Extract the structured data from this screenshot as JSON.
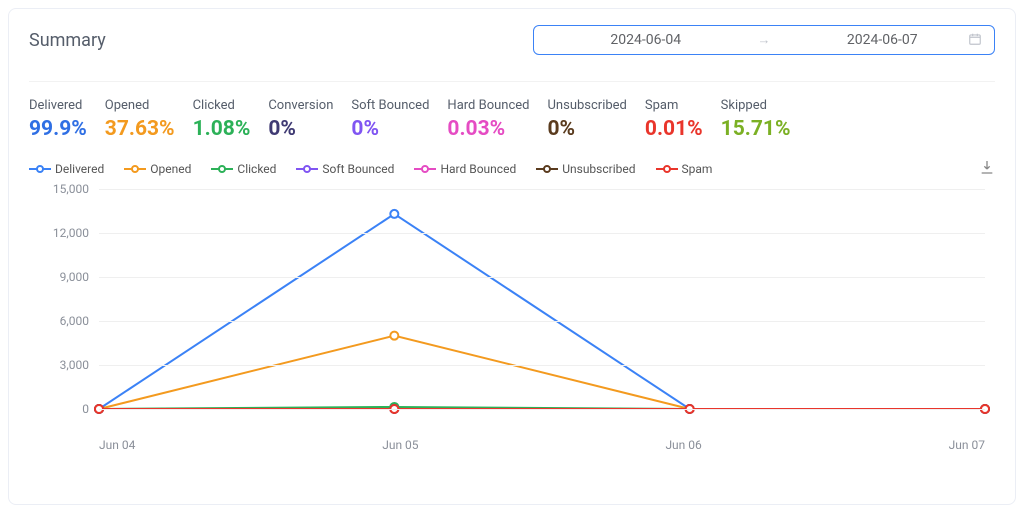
{
  "header": {
    "title": "Summary",
    "date_from": "2024-06-04",
    "date_to": "2024-06-07"
  },
  "stats": [
    {
      "label": "Delivered",
      "value": "99.9%",
      "color": "#2f6fe4"
    },
    {
      "label": "Opened",
      "value": "37.63%",
      "color": "#f39a1f"
    },
    {
      "label": "Clicked",
      "value": "1.08%",
      "color": "#2cb158"
    },
    {
      "label": "Conversion",
      "value": "0%",
      "color": "#3f3a73"
    },
    {
      "label": "Soft Bounced",
      "value": "0%",
      "color": "#8055f2"
    },
    {
      "label": "Hard Bounced",
      "value": "0.03%",
      "color": "#e54cc3"
    },
    {
      "label": "Unsubscribed",
      "value": "0%",
      "color": "#5a3b1e"
    },
    {
      "label": "Spam",
      "value": "0.01%",
      "color": "#e9352b"
    },
    {
      "label": "Skipped",
      "value": "15.71%",
      "color": "#7bb024"
    }
  ],
  "legend": [
    {
      "label": "Delivered",
      "color": "#3b82f6"
    },
    {
      "label": "Opened",
      "color": "#f39a1f"
    },
    {
      "label": "Clicked",
      "color": "#2cb158"
    },
    {
      "label": "Soft Bounced",
      "color": "#8055f2"
    },
    {
      "label": "Hard Bounced",
      "color": "#e54cc3"
    },
    {
      "label": "Unsubscribed",
      "color": "#5a3b1e"
    },
    {
      "label": "Spam",
      "color": "#e9352b"
    }
  ],
  "chart_data": {
    "type": "line",
    "categories": [
      "Jun 04",
      "Jun 05",
      "Jun 06",
      "Jun 07"
    ],
    "ylim": [
      0,
      15000
    ],
    "yticks": [
      0,
      3000,
      6000,
      9000,
      12000,
      15000
    ],
    "ytick_labels": [
      "0",
      "3,000",
      "6,000",
      "9,000",
      "12,000",
      "15,000"
    ],
    "series": [
      {
        "name": "Delivered",
        "color": "#3b82f6",
        "values": [
          0,
          13300,
          0,
          0
        ]
      },
      {
        "name": "Opened",
        "color": "#f39a1f",
        "values": [
          0,
          5000,
          0,
          0
        ]
      },
      {
        "name": "Clicked",
        "color": "#2cb158",
        "values": [
          0,
          140,
          0,
          0
        ]
      },
      {
        "name": "Soft Bounced",
        "color": "#8055f2",
        "values": [
          0,
          0,
          0,
          0
        ]
      },
      {
        "name": "Hard Bounced",
        "color": "#e54cc3",
        "values": [
          0,
          4,
          0,
          0
        ]
      },
      {
        "name": "Unsubscribed",
        "color": "#5a3b1e",
        "values": [
          0,
          0,
          0,
          0
        ]
      },
      {
        "name": "Spam",
        "color": "#e9352b",
        "values": [
          0,
          1,
          0,
          0
        ]
      }
    ]
  }
}
